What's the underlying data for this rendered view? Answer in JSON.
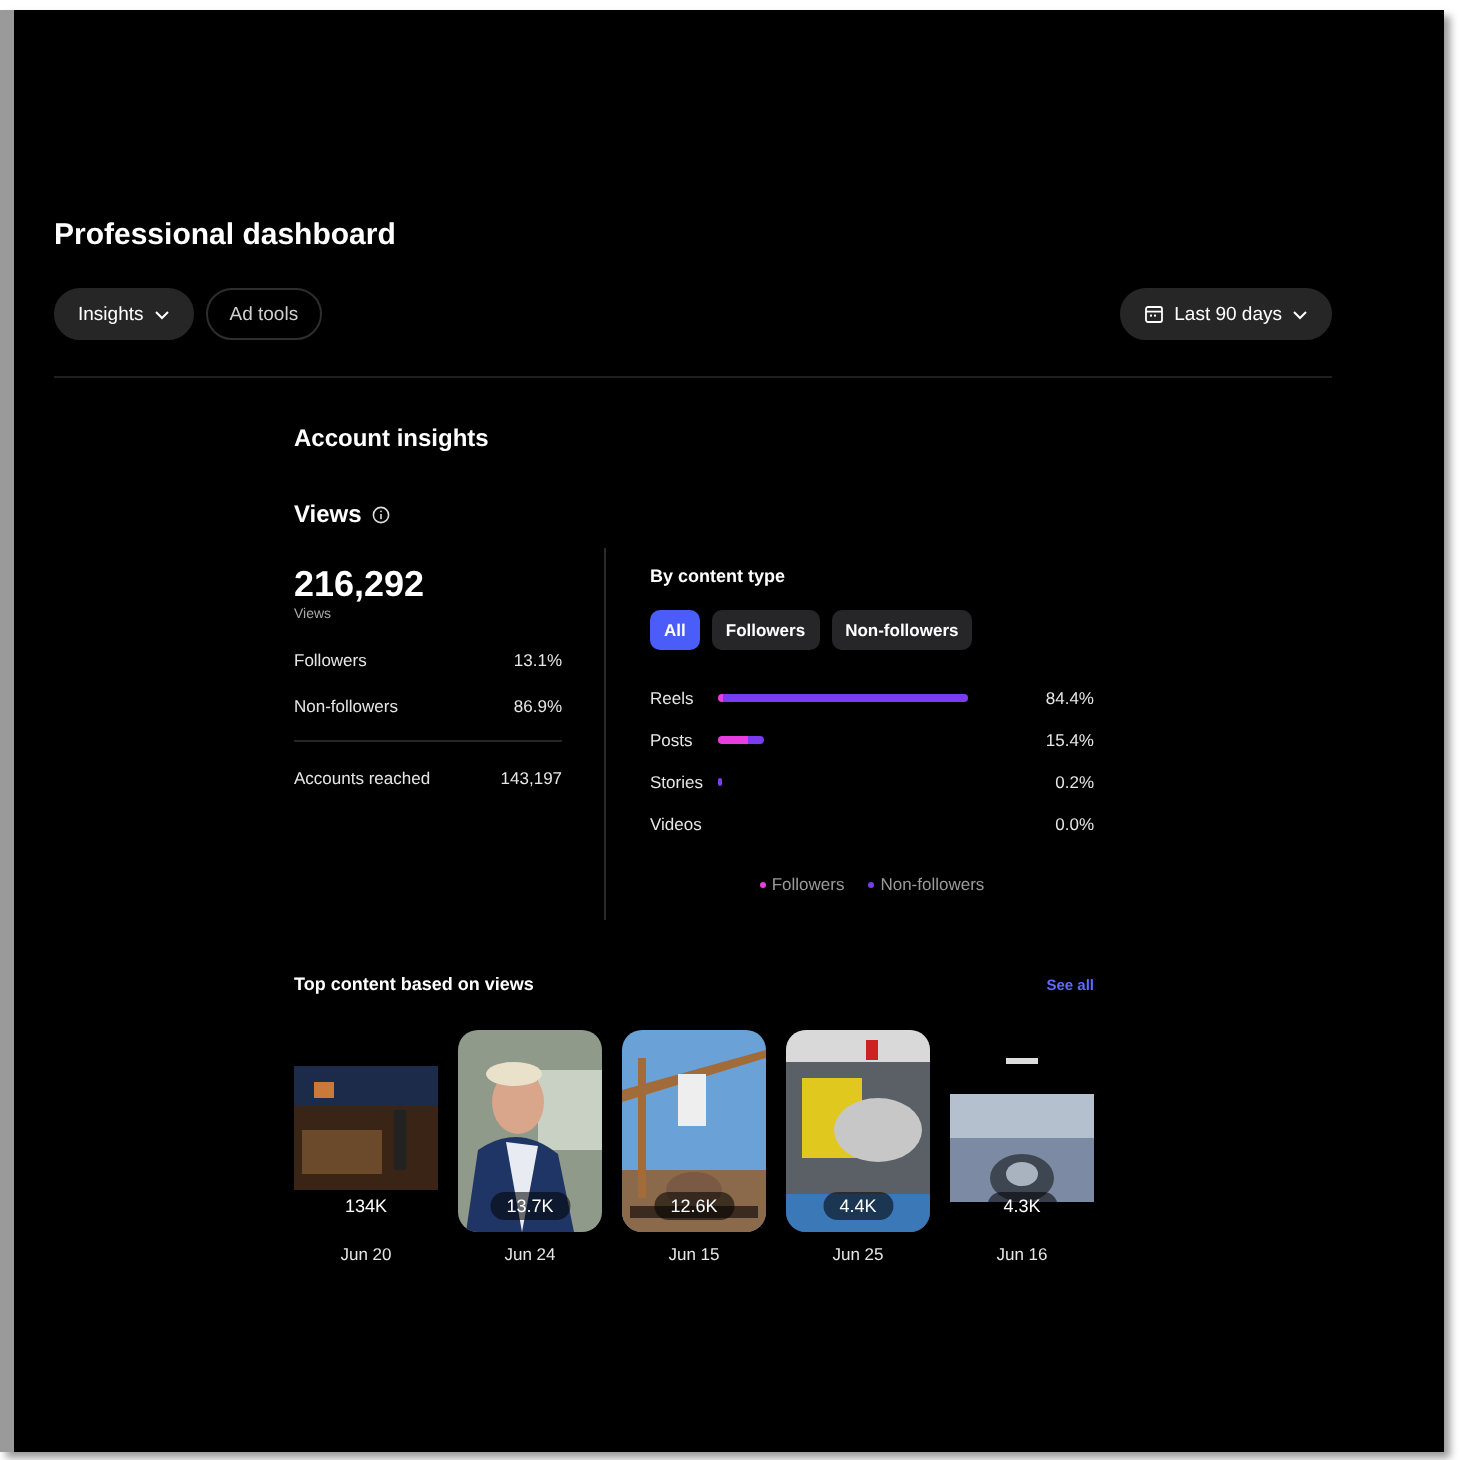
{
  "header": {
    "title": "Professional dashboard"
  },
  "nav": [
    {
      "label": "Insights",
      "selected": true,
      "kind": "dropdown"
    },
    {
      "label": "Ad tools",
      "selected": false,
      "kind": "plain"
    }
  ],
  "date_range": {
    "label": "Last 90 days"
  },
  "section_title": "Account insights",
  "views": {
    "title": "Views",
    "total": "216,292",
    "total_label": "Views",
    "breakdown": [
      {
        "label": "Followers",
        "value": "13.1%"
      },
      {
        "label": "Non-followers",
        "value": "86.9%"
      }
    ],
    "reached": {
      "label": "Accounts reached",
      "value": "143,197"
    }
  },
  "content_type": {
    "title": "By content type",
    "filters": [
      {
        "label": "All",
        "selected": true
      },
      {
        "label": "Followers",
        "selected": false
      },
      {
        "label": "Non-followers",
        "selected": false
      }
    ],
    "rows": [
      {
        "label": "Reels",
        "value": "84.4%"
      },
      {
        "label": "Posts",
        "value": "15.4%"
      },
      {
        "label": "Stories",
        "value": "0.2%"
      },
      {
        "label": "Videos",
        "value": "0.0%"
      }
    ],
    "legend": [
      {
        "label": "Followers",
        "color": "#e83ee0"
      },
      {
        "label": "Non-followers",
        "color": "#7a3cf0"
      }
    ]
  },
  "top_content": {
    "title": "Top content based on views",
    "link": "See all",
    "items": [
      {
        "views": "134K",
        "date": "Jun 20",
        "framed": false
      },
      {
        "views": "13.7K",
        "date": "Jun 24",
        "framed": true
      },
      {
        "views": "12.6K",
        "date": "Jun 15",
        "framed": true
      },
      {
        "views": "4.4K",
        "date": "Jun 25",
        "framed": true
      },
      {
        "views": "4.3K",
        "date": "Jun 16",
        "framed": false
      }
    ]
  }
}
